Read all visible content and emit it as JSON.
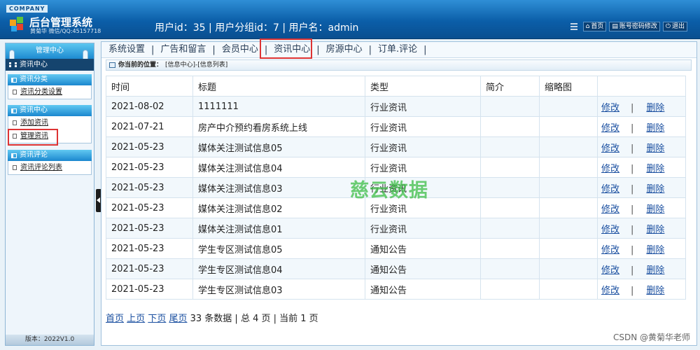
{
  "header": {
    "company": "COMPANY",
    "title": "后台管理系统",
    "subtitle": "黄菊华 微信/QQ:45157718",
    "user_info": "用户id：35 | 用户分组id：7 | 用户名：admin",
    "buttons": {
      "home": "首页",
      "account": "账号密码修改",
      "logout": "退出"
    }
  },
  "sidebar": {
    "heading": "管理中心",
    "current": "资讯中心",
    "sections": [
      {
        "title": "资讯分类",
        "items": [
          "资讯分类设置"
        ]
      },
      {
        "title": "资讯中心",
        "items": [
          "添加资讯",
          "管理资讯"
        ]
      },
      {
        "title": "资讯评论",
        "items": [
          "资讯评论列表"
        ]
      }
    ],
    "version": "版本：2022V1.0"
  },
  "tabs": [
    "系统设置",
    "广告和留言",
    "会员中心",
    "资讯中心",
    "房源中心",
    "订单.评论"
  ],
  "breadcrumb": {
    "label": "你当前的位置：",
    "path": "[信息中心]-[信息列表]"
  },
  "table": {
    "headers": [
      "时间",
      "标题",
      "类型",
      "简介",
      "缩略图",
      ""
    ],
    "rows": [
      {
        "date": "2021-08-02",
        "title": "1111111",
        "type": "行业资讯",
        "intro": "",
        "thumb": ""
      },
      {
        "date": "2021-07-21",
        "title": "房产中介预约看房系统上线",
        "type": "行业资讯",
        "intro": "",
        "thumb": ""
      },
      {
        "date": "2021-05-23",
        "title": "媒体关注测试信息05",
        "type": "行业资讯",
        "intro": "",
        "thumb": ""
      },
      {
        "date": "2021-05-23",
        "title": "媒体关注测试信息04",
        "type": "行业资讯",
        "intro": "",
        "thumb": ""
      },
      {
        "date": "2021-05-23",
        "title": "媒体关注测试信息03",
        "type": "行业资讯",
        "intro": "",
        "thumb": ""
      },
      {
        "date": "2021-05-23",
        "title": "媒体关注测试信息02",
        "type": "行业资讯",
        "intro": "",
        "thumb": ""
      },
      {
        "date": "2021-05-23",
        "title": "媒体关注测试信息01",
        "type": "行业资讯",
        "intro": "",
        "thumb": ""
      },
      {
        "date": "2021-05-23",
        "title": "学生专区测试信息05",
        "type": "通知公告",
        "intro": "",
        "thumb": ""
      },
      {
        "date": "2021-05-23",
        "title": "学生专区测试信息04",
        "type": "通知公告",
        "intro": "",
        "thumb": ""
      },
      {
        "date": "2021-05-23",
        "title": "学生专区测试信息03",
        "type": "通知公告",
        "intro": "",
        "thumb": ""
      }
    ],
    "edit_label": "修改",
    "sep": "|",
    "delete_label": "删除"
  },
  "pager": {
    "first": "首页",
    "prev": "上页",
    "next": "下页",
    "last": "尾页",
    "summary": "33 条数据 | 总 4 页 | 当前 1 页"
  },
  "watermark": "慈云数据",
  "credit": "CSDN @黄菊华老师",
  "colors": {
    "header": "#0b5ea8",
    "accent": "#1d8ad1",
    "highlight": "#dd3333",
    "link": "#1a4fa0"
  }
}
